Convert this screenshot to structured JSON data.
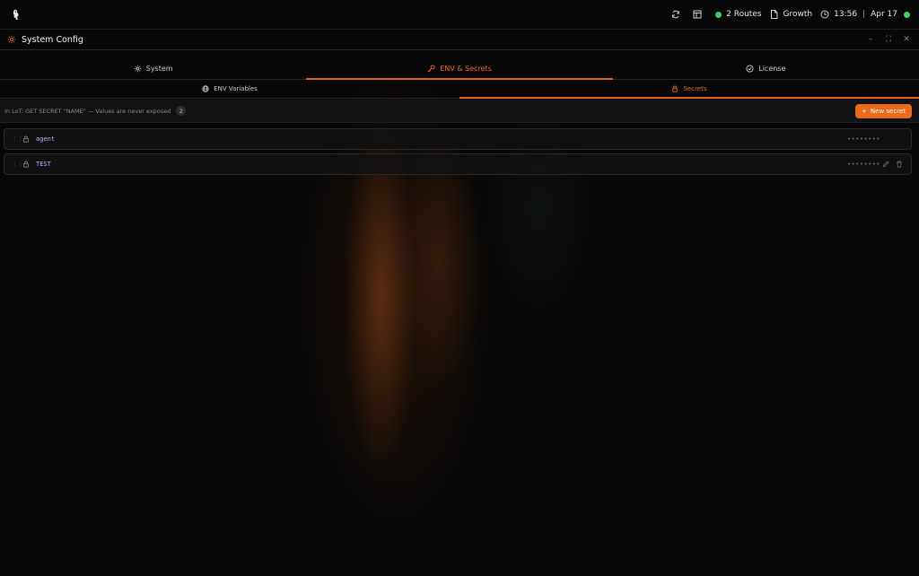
{
  "topbar": {
    "status": {
      "routes": "2 Routes",
      "plan": "Growth",
      "time": "13:56",
      "date": "Apr 17",
      "accent_green": "#3fcf6a"
    },
    "icons": [
      "logo",
      "refresh-icon",
      "layout-icon",
      "document-icon",
      "clock-icon"
    ]
  },
  "window": {
    "title": "System Config",
    "controls": [
      "minimize",
      "maximize",
      "close"
    ]
  },
  "main_tabs": [
    {
      "label": "System",
      "icon": "gear-icon",
      "active": false
    },
    {
      "label": "ENV & Secrets",
      "icon": "key-icon",
      "active": true
    },
    {
      "label": "License",
      "icon": "check-circle-icon",
      "active": false
    }
  ],
  "sub_tabs": [
    {
      "label": "ENV Variables",
      "icon": "globe-icon",
      "active": false
    },
    {
      "label": "Secrets",
      "icon": "lock-icon",
      "active": true
    }
  ],
  "toolbar": {
    "hint": "In LoT: GET SECRET \"NAME\" — Values are never exposed",
    "count": "2",
    "new_button": "New secret"
  },
  "secrets": [
    {
      "name": "agent",
      "masked": "••••••••"
    },
    {
      "name": "TEST",
      "masked": "••••••••"
    }
  ],
  "colors": {
    "accent": "#e8621f",
    "secret_name": "#c9a9ff",
    "background": "#070707"
  }
}
